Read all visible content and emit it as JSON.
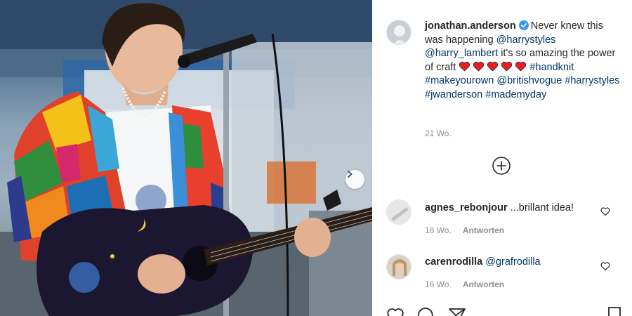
{
  "post": {
    "author": "jonathan.anderson",
    "verified": true,
    "caption_text_1": "Never knew this was happening",
    "caption_mention_1": "@harrystyles",
    "caption_mention_2": "@harry_lambert",
    "caption_text_2": "it's so amazing the power of craft",
    "hearts": 5,
    "caption_hashtags": "#handknit #makeyourown @britishvogue #harrystyles #jwanderson #mademyday",
    "time_ago": "21 Wo."
  },
  "comments": [
    {
      "username": "agnes_rebonjour",
      "text": "...brillant idea!",
      "time_ago": "18 Wo.",
      "reply_label": "Antworten"
    },
    {
      "username": "carenrodilla",
      "text": "@grafrodilla",
      "time_ago": "16 Wo.",
      "reply_label": "Antworten"
    }
  ],
  "colors": {
    "text": "#262626",
    "secondary": "#8e8e8e",
    "link": "#00376b",
    "verified": "#3897f0",
    "heart": "#ed1c24"
  },
  "icons": {
    "verified": "verified-badge-icon",
    "heart_emoji": "red-heart-icon",
    "more_comments": "plus-circle-icon",
    "comment_like": "heart-outline-icon",
    "next": "chevron-right-icon",
    "like": "heart-outline-icon",
    "comment": "speech-bubble-icon",
    "share": "paper-plane-icon",
    "save": "bookmark-icon"
  }
}
